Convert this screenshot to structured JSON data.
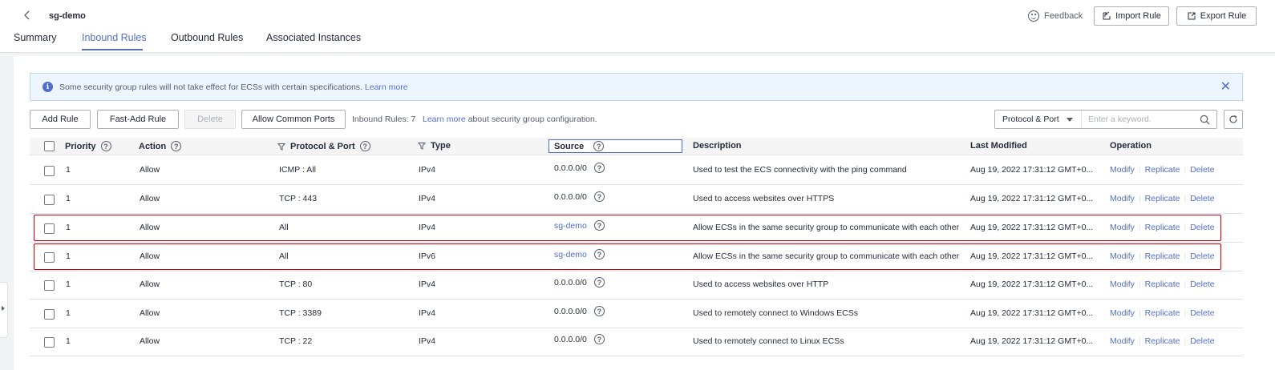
{
  "header": {
    "title": "sg-demo",
    "feedback": "Feedback",
    "import_rule": "Import Rule",
    "export_rule": "Export Rule"
  },
  "tabs": [
    {
      "label": "Summary"
    },
    {
      "label": "Inbound Rules",
      "active": true
    },
    {
      "label": "Outbound Rules"
    },
    {
      "label": "Associated Instances"
    }
  ],
  "notice": {
    "text": "Some security group rules will not take effect for ECSs with certain specifications.",
    "link": "Learn more"
  },
  "toolbar": {
    "add_rule": "Add Rule",
    "fast_add_rule": "Fast-Add Rule",
    "delete": "Delete",
    "allow_common_ports": "Allow Common Ports",
    "inbound_count": "Inbound Rules: 7",
    "learn_more": "Learn more",
    "learn_more_suffix": "about security group configuration."
  },
  "search": {
    "filter": "Protocol & Port",
    "placeholder": "Enter a keyword."
  },
  "columns": {
    "priority": "Priority",
    "action": "Action",
    "protocol_port": "Protocol & Port",
    "type": "Type",
    "source": "Source",
    "description": "Description",
    "last_modified": "Last Modified",
    "operation": "Operation"
  },
  "operations": {
    "modify": "Modify",
    "replicate": "Replicate",
    "delete": "Delete"
  },
  "rows": [
    {
      "priority": "1",
      "action": "Allow",
      "protocol_port": "ICMP : All",
      "type": "IPv4",
      "source": "0.0.0.0/0",
      "source_link": false,
      "description": "Used to test the ECS connectivity with the ping command",
      "last_modified": "Aug 19, 2022 17:31:12 GMT+0..."
    },
    {
      "priority": "1",
      "action": "Allow",
      "protocol_port": "TCP : 443",
      "type": "IPv4",
      "source": "0.0.0.0/0",
      "source_link": false,
      "description": "Used to access websites over HTTPS",
      "last_modified": "Aug 19, 2022 17:31:12 GMT+0..."
    },
    {
      "priority": "1",
      "action": "Allow",
      "protocol_port": "All",
      "type": "IPv4",
      "source": "sg-demo",
      "source_link": true,
      "description": "Allow ECSs in the same security group to communicate with each other",
      "last_modified": "Aug 19, 2022 17:31:12 GMT+0...",
      "highlighted": true
    },
    {
      "priority": "1",
      "action": "Allow",
      "protocol_port": "All",
      "type": "IPv6",
      "source": "sg-demo",
      "source_link": true,
      "description": "Allow ECSs in the same security group to communicate with each other",
      "last_modified": "Aug 19, 2022 17:31:12 GMT+0...",
      "highlighted": true
    },
    {
      "priority": "1",
      "action": "Allow",
      "protocol_port": "TCP : 80",
      "type": "IPv4",
      "source": "0.0.0.0/0",
      "source_link": false,
      "description": "Used to access websites over HTTP",
      "last_modified": "Aug 19, 2022 17:31:12 GMT+0..."
    },
    {
      "priority": "1",
      "action": "Allow",
      "protocol_port": "TCP : 3389",
      "type": "IPv4",
      "source": "0.0.0.0/0",
      "source_link": false,
      "description": "Used to remotely connect to Windows ECSs",
      "last_modified": "Aug 19, 2022 17:31:12 GMT+0..."
    },
    {
      "priority": "1",
      "action": "Allow",
      "protocol_port": "TCP : 22",
      "type": "IPv4",
      "source": "0.0.0.0/0",
      "source_link": false,
      "description": "Used to remotely connect to Linux ECSs",
      "last_modified": "Aug 19, 2022 17:31:12 GMT+0..."
    }
  ],
  "colors": {
    "accent": "#526ecc",
    "highlight": "#c7000b"
  }
}
